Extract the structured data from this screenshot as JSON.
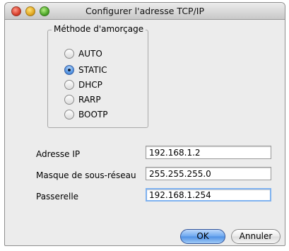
{
  "window": {
    "title": "Configurer l'adresse TCP/IP"
  },
  "boot_method": {
    "label": "Méthode d'amorçage",
    "selected": "STATIC",
    "options": [
      "AUTO",
      "STATIC",
      "DHCP",
      "RARP",
      "BOOTP"
    ]
  },
  "fields": {
    "ip_label": "Adresse IP",
    "ip_value": "192.168.1.2",
    "mask_label": "Masque de sous-réseau",
    "mask_value": "255.255.255.0",
    "gateway_label": "Passerelle",
    "gateway_value": "192.168.1.254"
  },
  "buttons": {
    "ok": "OK",
    "cancel": "Annuler"
  }
}
